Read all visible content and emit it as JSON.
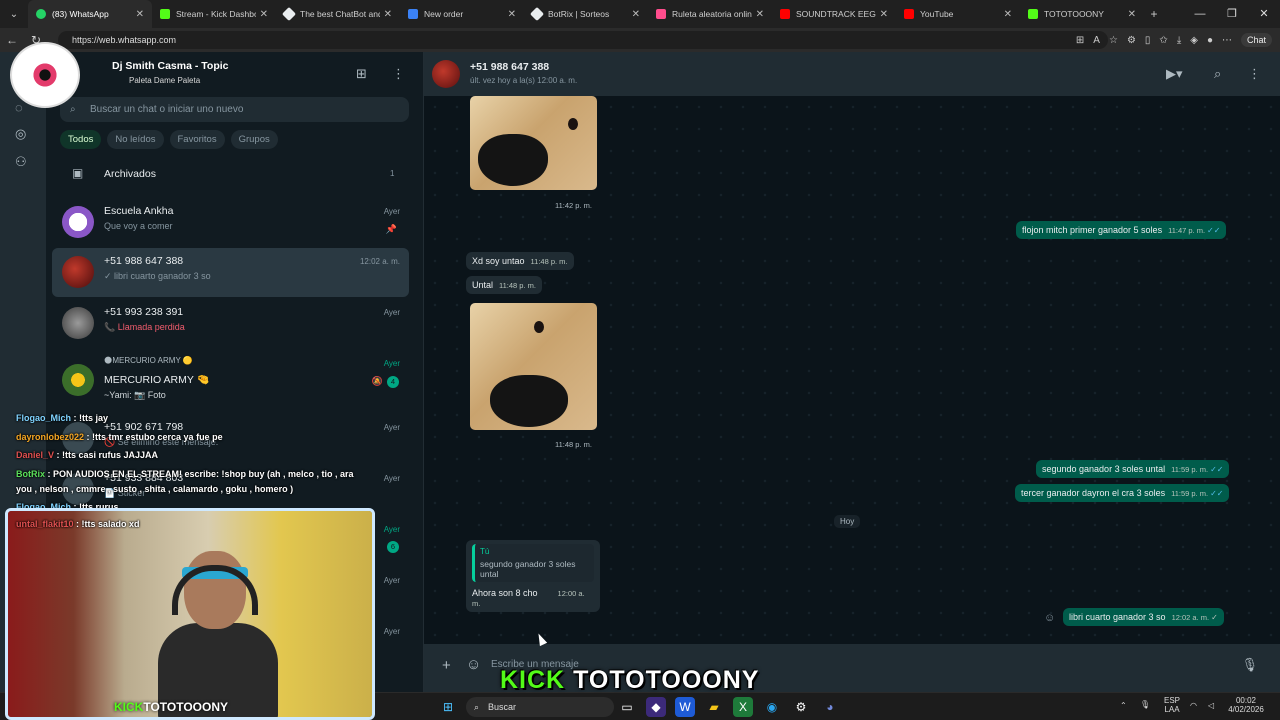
{
  "browser": {
    "tabs": [
      {
        "label": "(83) WhatsApp",
        "color": "#25d366"
      },
      {
        "label": "Stream - Kick Dashboard",
        "color": "#53fc18"
      },
      {
        "label": "The best ChatBot and W",
        "color": "#e9edef"
      },
      {
        "label": "New order",
        "color": "#3b82f6"
      },
      {
        "label": "BotRix | Sorteos",
        "color": "#e9edef"
      },
      {
        "label": "Ruleta aleatoria online",
        "color": "#ff4d8d"
      },
      {
        "label": "SOUNDTRACK EEG",
        "color": "#ff0000"
      },
      {
        "label": "YouTube",
        "color": "#ff0000"
      },
      {
        "label": "TOTOTOOONY",
        "color": "#53fc18"
      }
    ],
    "url": "https://web.whatsapp.com",
    "chat_button": "Chat"
  },
  "sidebar": {
    "title": "Dj Smith Casma - Topic",
    "subtitle": "Paleta Dame Paleta",
    "search_placeholder": "Buscar un chat o iniciar uno nuevo",
    "filters": [
      "Todos",
      "No leídos",
      "Favoritos",
      "Grupos"
    ],
    "archived_label": "Archivados",
    "archived_count": "1",
    "chats": [
      {
        "name": "Escuela Ankha",
        "msg": "Que voy a comer",
        "time": "Ayer"
      },
      {
        "name": "+51 988 647 388",
        "msg": "✓ libri cuarto ganador 3 so",
        "time": "12:02 a. m."
      },
      {
        "name": "+51 993 238 391",
        "msg": "📞 Llamada perdida",
        "time": "Ayer"
      },
      {
        "name": "MERCURIO ARMY 🤏",
        "msg": "~Yami: 📷 Foto",
        "time": "Ayer",
        "header": "🌑MERCURIO ARMY 🟡",
        "badge": "4"
      },
      {
        "name": "+51 902 671 798",
        "msg": "🚫 Se eliminó este mensaje.",
        "time": "Ayer"
      },
      {
        "name": "+51 933 884 803",
        "msg": "📄 Sticker",
        "time": "Ayer"
      },
      {
        "name": "",
        "msg": "",
        "time": "Ayer",
        "badge": "6"
      },
      {
        "name": "",
        "msg": "",
        "time": "Ayer"
      },
      {
        "name": "",
        "msg": "",
        "time": "Ayer"
      }
    ]
  },
  "chat": {
    "name": "+51 988 647 388",
    "status": "últ. vez hoy a la(s) 12:00 a. m.",
    "img1_time": "11:42 p. m.",
    "out1": {
      "text": "flojon mitch primer ganador 5 soles",
      "time": "11:47 p. m."
    },
    "in1": {
      "text": "Xd soy untao",
      "time": "11:48 p. m."
    },
    "in2": {
      "text": "Untal",
      "time": "11:48 p. m."
    },
    "img2_time": "11:48 p. m.",
    "out2": {
      "text": "segundo ganador 3 soles untal",
      "time": "11:59 p. m."
    },
    "out3": {
      "text": "tercer ganador dayron el cra 3 soles",
      "time": "11:59 p. m."
    },
    "day": "Hoy",
    "reply": {
      "quote_author": "Tú",
      "quote_text": "segundo ganador 3 soles untal",
      "text": "Ahora son 8 cho",
      "time": "12:00 a. m."
    },
    "out4": {
      "text": "libri cuarto ganador 3 so",
      "time": "12:02 a. m."
    },
    "composer_placeholder": "Escribe un mensaje"
  },
  "overlay": {
    "lines": [
      {
        "user": "Flogao_Mich",
        "text": " : !tts jay"
      },
      {
        "user": "dayronlobez022",
        "text": " : !tts tmr estubo cerca ya fue pe"
      },
      {
        "user": "Daniel_V",
        "text": " : !tts casi rufus JAJJAA"
      },
      {
        "user": "BotRix",
        "text": " : PON AUDIOS EN EL STREAM! escribe: !shop buy (ah , melco , tio , ara"
      },
      {
        "user": "",
        "text": "you , nelson , cmmre , susto , shita , calamardo , goku , homero )"
      },
      {
        "user": "Flogao_Mich",
        "text": " : !tts rurus"
      },
      {
        "user": "untal_flakit10",
        "text": " : !tts salado xd"
      }
    ],
    "brand_kick": "KICK",
    "brand_name": "TOTOTOOONY"
  },
  "taskbar": {
    "search": "Buscar",
    "lang": "ESP",
    "lang2": "LAA",
    "time": "00:02",
    "date": "4/02/2026"
  }
}
